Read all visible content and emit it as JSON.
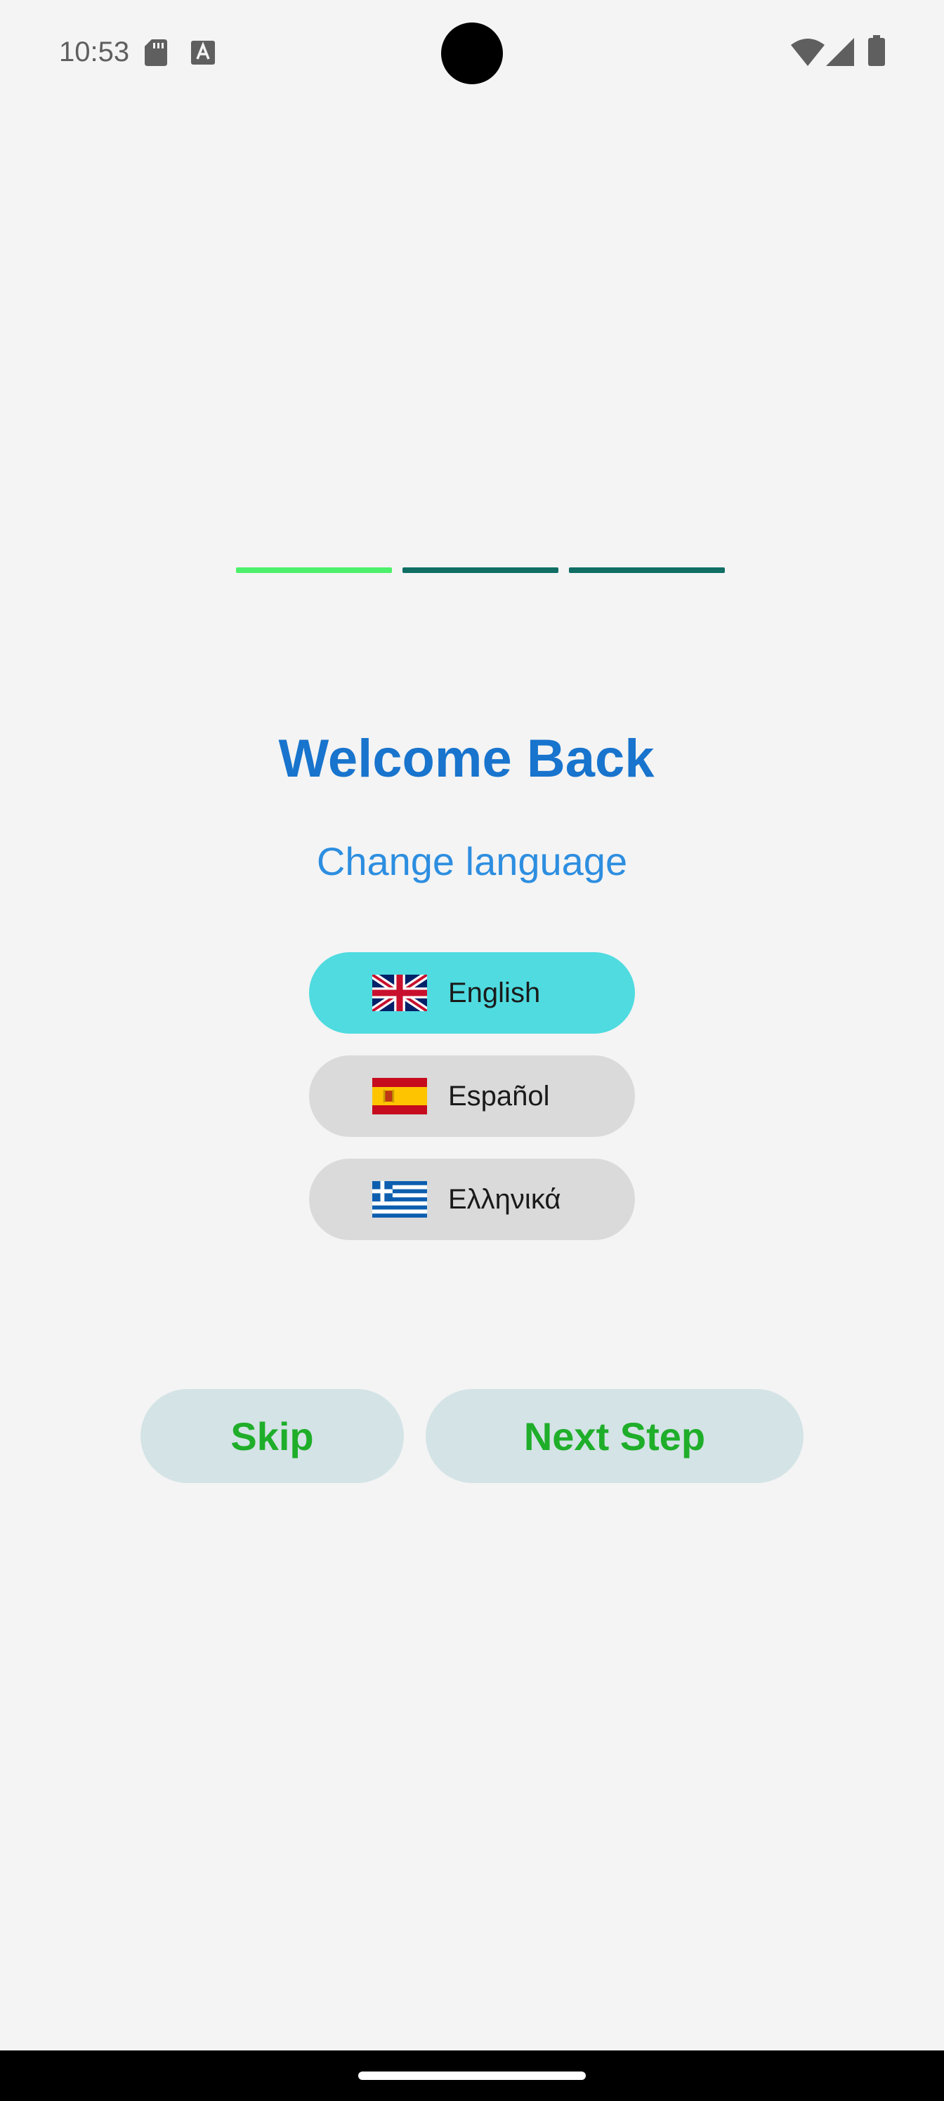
{
  "status_bar": {
    "time": "10:53",
    "icons": [
      "sd-card-icon",
      "text-a-icon",
      "wifi-icon",
      "signal-icon",
      "battery-icon"
    ]
  },
  "progress": {
    "steps": 3,
    "current": 1,
    "active_color": "#4cf06a",
    "inactive_color": "#106e64"
  },
  "welcome": {
    "title": "Welcome Back",
    "subtitle": "Change language"
  },
  "languages": [
    {
      "label": "English",
      "flag": "uk-flag-icon",
      "selected": true
    },
    {
      "label": "Español",
      "flag": "spain-flag-icon",
      "selected": false
    },
    {
      "label": "Ελληνικά",
      "flag": "greece-flag-icon",
      "selected": false
    }
  ],
  "actions": {
    "skip_label": "Skip",
    "next_label": "Next Step"
  },
  "colors": {
    "title": "#1874cd",
    "subtitle": "#2d8ee0",
    "selected_language": "#4fdbe0",
    "unselected_language": "#d9dad9",
    "action_text": "#1fae2a",
    "action_background": "#d4e3e6"
  }
}
